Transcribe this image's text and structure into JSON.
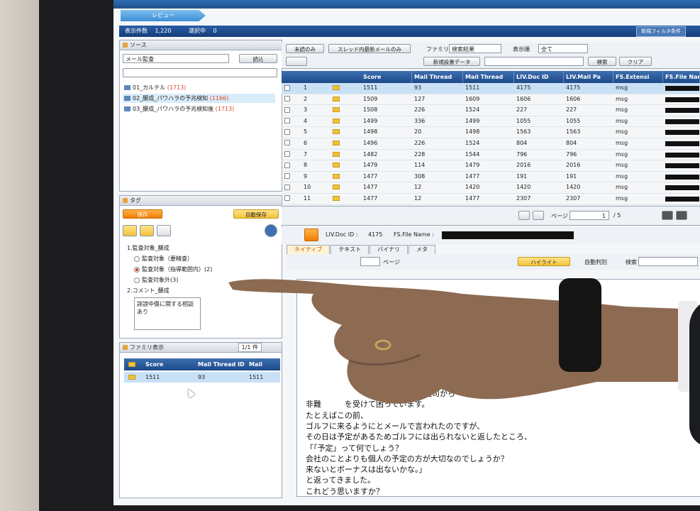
{
  "app": {
    "crumb": "レビュー",
    "new_filter": "新規フィルタ条件"
  },
  "counts": {
    "display_label": "表示件数",
    "display_value": "1,220",
    "selected_label": "選択中",
    "selected_value": "0"
  },
  "source": {
    "title": "ソース",
    "dropdown": "メール監査",
    "load_button": "読込",
    "items": [
      {
        "label": "01_カルテル",
        "count": "(1713)"
      },
      {
        "label": "02_醸成_パワハラの予兆検知",
        "count": "(1166)"
      },
      {
        "label": "03_醸成_パワハラの予兆検知後",
        "count": "(1713)"
      }
    ]
  },
  "tag": {
    "title": "タグ",
    "save": "保存",
    "autosave": "自動保存",
    "group1": "1.監査対象_醸成",
    "options": [
      "監査対象（要精査）",
      "監査対象（指導範囲内）(2)",
      "監査対象外(3)"
    ],
    "group2": "2.コメント_醸成",
    "comment": "誹謗中傷に関する相談あり"
  },
  "family": {
    "title": "ファミリ表示",
    "pager": "1/1 件",
    "headers": [
      "Score",
      "Mail Thread ID",
      "Mail Threa"
    ],
    "row": [
      "1511",
      "93",
      "1511"
    ]
  },
  "toolbar": {
    "unread_only": "未読のみ",
    "latest_only": "スレッド内最新メールのみ",
    "family_label": "ファミリ",
    "family_value": "検索結果",
    "display_format_label": "表示順",
    "display_format_value": "全て",
    "new_search": "新規設置データ",
    "search": "検索",
    "clear": "クリア"
  },
  "grid": {
    "headers": [
      "Score",
      "Mail Thread",
      "Mail Thread",
      "LIV.Doc ID",
      "LIV.Mail Pa",
      "FS.Extensi",
      "FS.File Nar"
    ],
    "rows": [
      [
        "1",
        "1511",
        "93",
        "1511",
        "4175",
        "4175",
        "msg"
      ],
      [
        "2",
        "1509",
        "127",
        "1609",
        "1606",
        "1606",
        "msg"
      ],
      [
        "3",
        "1508",
        "226",
        "1524",
        "227",
        "227",
        "msg"
      ],
      [
        "4",
        "1499",
        "336",
        "1499",
        "1055",
        "1055",
        "msg"
      ],
      [
        "5",
        "1498",
        "20",
        "1498",
        "1563",
        "1563",
        "msg"
      ],
      [
        "6",
        "1496",
        "226",
        "1524",
        "804",
        "804",
        "msg"
      ],
      [
        "7",
        "1482",
        "228",
        "1544",
        "796",
        "796",
        "msg"
      ],
      [
        "8",
        "1479",
        "114",
        "1479",
        "2016",
        "2016",
        "msg"
      ],
      [
        "9",
        "1477",
        "308",
        "1477",
        "191",
        "191",
        "msg"
      ],
      [
        "10",
        "1477",
        "12",
        "1420",
        "1420",
        "1420",
        "msg"
      ],
      [
        "11",
        "1477",
        "12",
        "1477",
        "2307",
        "2307",
        "msg"
      ]
    ],
    "page_label": "ページ",
    "page_value": "1",
    "page_total": "/ 5"
  },
  "viewer": {
    "doc_id_label": "LIV.Doc ID :",
    "doc_id": "4175",
    "file_label": "FS.File Name :",
    "tabs": [
      "ネイティブ",
      "テキスト",
      "バイナリ",
      "メタ"
    ],
    "page_label": "ページ",
    "highlight": "ハイライト",
    "auto_judge": "自動判別",
    "search_label": "検索",
    "lines": [
      "さんという上司から",
      "非難　　　を受けて困っています。",
      "たとえばこの前、",
      "ゴルフに来るようにとメールで言われたのですが、",
      "その日は予定があるためゴルフには出られないと返したところ、",
      "「「予定」って何でしょう？",
      "会社のことよりも個人の予定の方が大切なのでしょうか？",
      "来ないとボーナスは出ないかな。」",
      "と返ってきました。",
      "これどう思いますか？"
    ]
  },
  "colors": {
    "header_blue": "#1f4f8c",
    "accent_orange": "#f07d00",
    "selected_row": "#c9e1f6",
    "count_red": "#e0452c"
  }
}
